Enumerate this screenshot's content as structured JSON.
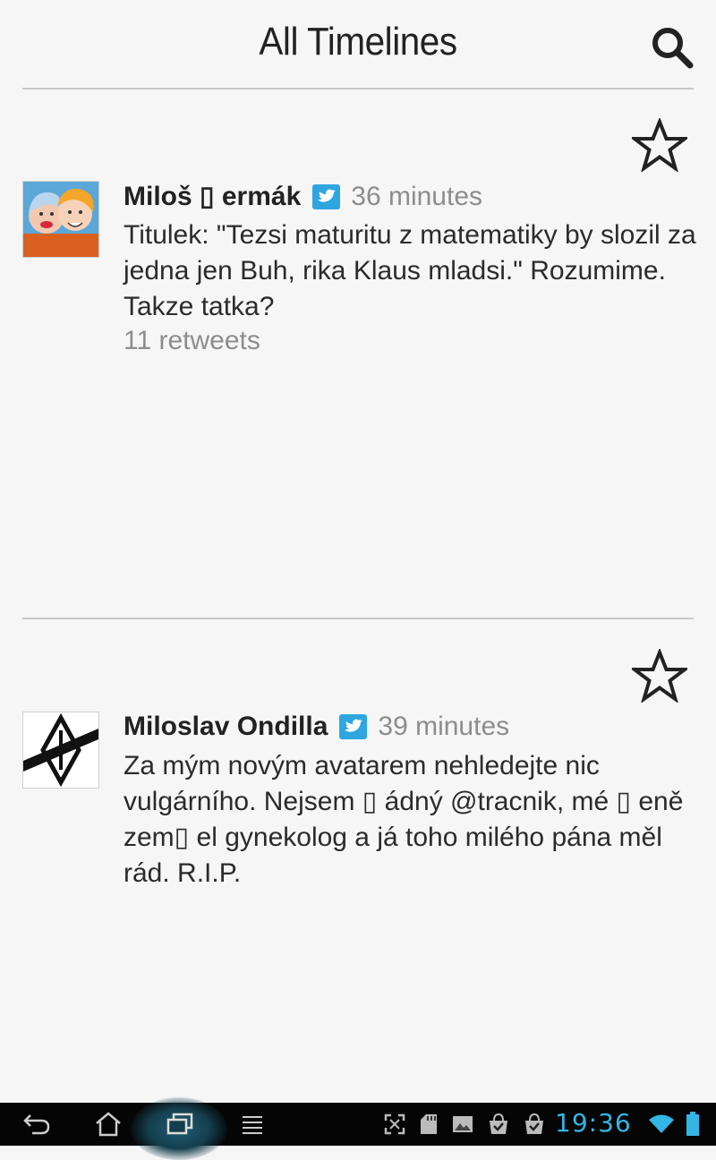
{
  "header": {
    "title": "All Timelines",
    "search_icon": "search-icon"
  },
  "tweets": [
    {
      "author": "Miloš ▯ ermák",
      "source_icon": "twitter-bird-icon",
      "time": "36 minutes",
      "text": "Titulek: \"Tezsi maturitu z matematiky by slozil za\njedna jen Buh, rika Klaus mladsi.\" Rozumime.\nTakze tatka?",
      "retweets": "11 retweets",
      "favorite_icon": "star-icon"
    },
    {
      "author": "Miloslav Ondilla",
      "source_icon": "twitter-bird-icon",
      "time": "39 minutes",
      "text": "Za mým novým avatarem nehledejte nic\nvulgárního. Nejsem ▯ ádný @tracnik, mé ▯ eně\nzem▯ el gynekolog a já toho milého pána měl\nrád. R.I.P.",
      "favorite_icon": "star-icon"
    }
  ],
  "navbar": {
    "buttons": [
      "back-icon",
      "home-icon",
      "recent-apps-icon",
      "menu-icon"
    ],
    "status_icons": [
      "screenshot-icon",
      "sd-card-icon",
      "gallery-icon",
      "shopping-bag-icon",
      "shopping-bag-icon"
    ],
    "clock": "19:36",
    "status_color": "#33b5e5"
  }
}
